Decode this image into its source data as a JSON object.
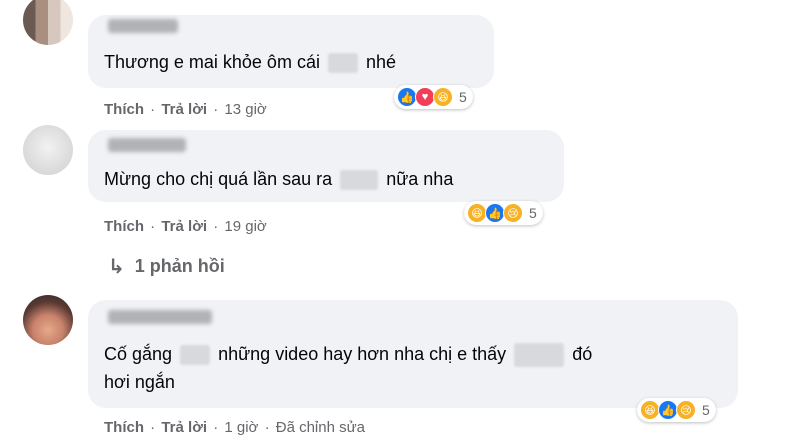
{
  "comments": [
    {
      "text_before": "Thương e mai khỏe ôm cái",
      "text_after": "nhé",
      "actions": {
        "like": "Thích",
        "reply": "Trả lời",
        "time": "13 giờ"
      },
      "reactions": {
        "icons": [
          "like-icon",
          "love-icon",
          "haha-icon"
        ],
        "count": "5"
      }
    },
    {
      "text_before": "Mừng cho chị quá lần sau ra",
      "text_after": "nữa nha",
      "actions": {
        "like": "Thích",
        "reply": "Trả lời",
        "time": "19 giờ"
      },
      "reactions": {
        "icons": [
          "haha-icon",
          "like-icon",
          "sad-icon"
        ],
        "count": "5"
      },
      "replies": {
        "label": "1 phản hồi"
      }
    },
    {
      "line1_before": "Cố gắng",
      "line1_middle": "những video hay hơn nha chị e thấy",
      "line1_after": "đó",
      "line2": "hơi ngắn",
      "actions": {
        "like": "Thích",
        "reply": "Trả lời",
        "time": "1 giờ",
        "edited": "Đã chỉnh sửa"
      },
      "reactions": {
        "icons": [
          "haha-icon",
          "like-icon",
          "sad-icon"
        ],
        "count": "5"
      }
    }
  ],
  "separator": "·",
  "colors": {
    "bubble": "#f0f2f5",
    "secondary_text": "#65676b",
    "like": "#1877f2",
    "love": "#f33e58",
    "haha": "#f7b125"
  }
}
